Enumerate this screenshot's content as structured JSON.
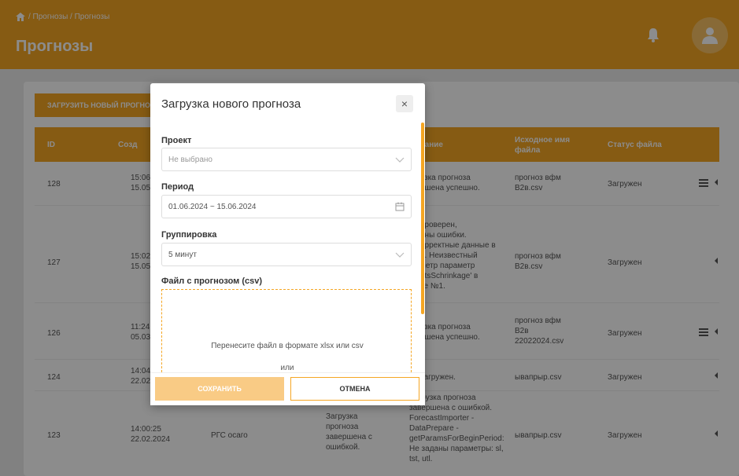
{
  "header": {
    "breadcrumb": "/ Прогнозы / Прогнозы",
    "title": "Прогнозы"
  },
  "toolbar": {
    "upload_label": "ЗАГРУЗИТЬ НОВЫЙ ПРОГНОЗ"
  },
  "table": {
    "headers": [
      "ID",
      "Созд",
      "сание",
      "Исходное имя файла",
      "Статус файла"
    ],
    "rows": [
      {
        "id": "128",
        "created": "15:06\n15.05.",
        "desc": "узка прогноза\nршена успешно.",
        "file": "прогноз вфм\nB2в.csv",
        "status": "Загружен"
      },
      {
        "id": "127",
        "created": "15:02\n15.05.",
        "desc": "проверен,\nены ошибки.\nорректные данные в\nе. Неизвестный\nметр параметр\nntsSchrinkage' в\nке №1.",
        "file": "прогноз вфм\nB2в.csv",
        "status": "Загружен"
      },
      {
        "id": "126",
        "created": "11:24\n05.03.",
        "desc": "узка прогноза\nршена успешно.",
        "file": "прогноз вфм\nB2в\n22022024.csv",
        "status": "Загружен"
      },
      {
        "id": "124",
        "created": "14:04\n22.02.",
        "desc": "загружен.",
        "file": "ывапрыр.csv",
        "status": "Загружен"
      },
      {
        "id": "123",
        "created": "14:00:25\n22.02.2024",
        "project": "РГС осаго",
        "state": "Загрузка\nпрогноза\nзавершена с\nошибкой.",
        "desc": "Загрузка прогноза\nзавершена с ошибкой.\nForecastImporter -\nDataPrepare -\ngetParamsForBeginPeriod:\nНе заданы параметры: sl,\ntst, utl.",
        "file": "ывапрыр.csv",
        "status": "Загружен"
      }
    ]
  },
  "modal": {
    "title": "Загрузка нового прогноза",
    "close": "×",
    "project_label": "Проект",
    "project_placeholder": "Не выбрано",
    "period_label": "Период",
    "period_value": "01.06.2024 ~ 15.06.2024",
    "grouping_label": "Группировка",
    "grouping_value": "5 минут",
    "file_label": "Файл с прогнозом (csv)",
    "drop_text": "Перенесите файл в формате xlsx или csv",
    "or_text": "или",
    "save_label": "СОХРАНИТЬ",
    "cancel_label": "ОТМЕНА"
  },
  "colors": {
    "accent": "#f5a623"
  }
}
